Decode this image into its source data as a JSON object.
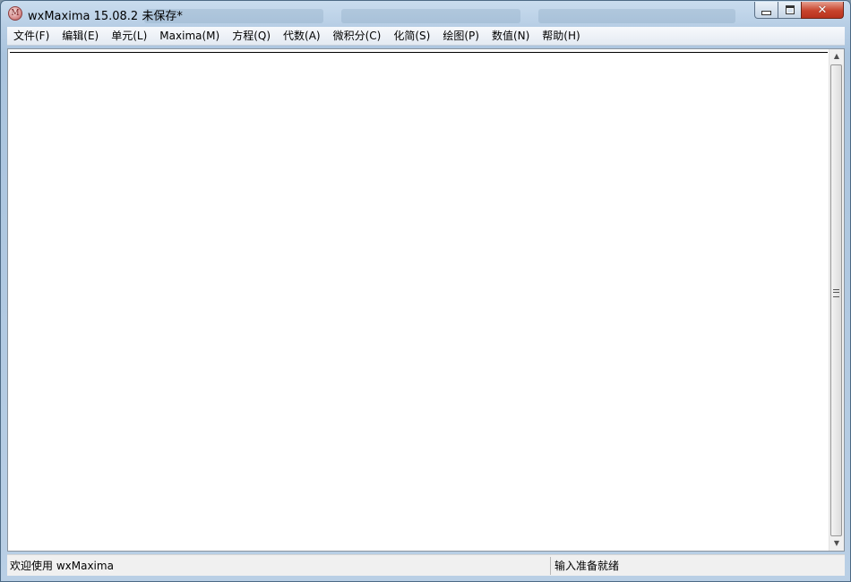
{
  "window": {
    "title": "wxMaxima 15.08.2 未保存*",
    "icon": "maxima-app-icon"
  },
  "controls": {
    "minimize": "minimize-icon",
    "maximize": "maximize-icon",
    "close": "✕"
  },
  "menu": [
    {
      "label": "文件(F)"
    },
    {
      "label": "编辑(E)"
    },
    {
      "label": "单元(L)"
    },
    {
      "label": "Maxima(M)"
    },
    {
      "label": "方程(Q)"
    },
    {
      "label": "代数(A)"
    },
    {
      "label": "微积分(C)"
    },
    {
      "label": "化简(S)"
    },
    {
      "label": "绘图(P)"
    },
    {
      "label": "数值(N)"
    },
    {
      "label": "帮助(H)"
    }
  ],
  "scrollbar": {
    "up_arrow": "▲",
    "down_arrow": "▼"
  },
  "status": {
    "left": "欢迎使用 wxMaxima",
    "right": "输入准备就绪"
  }
}
